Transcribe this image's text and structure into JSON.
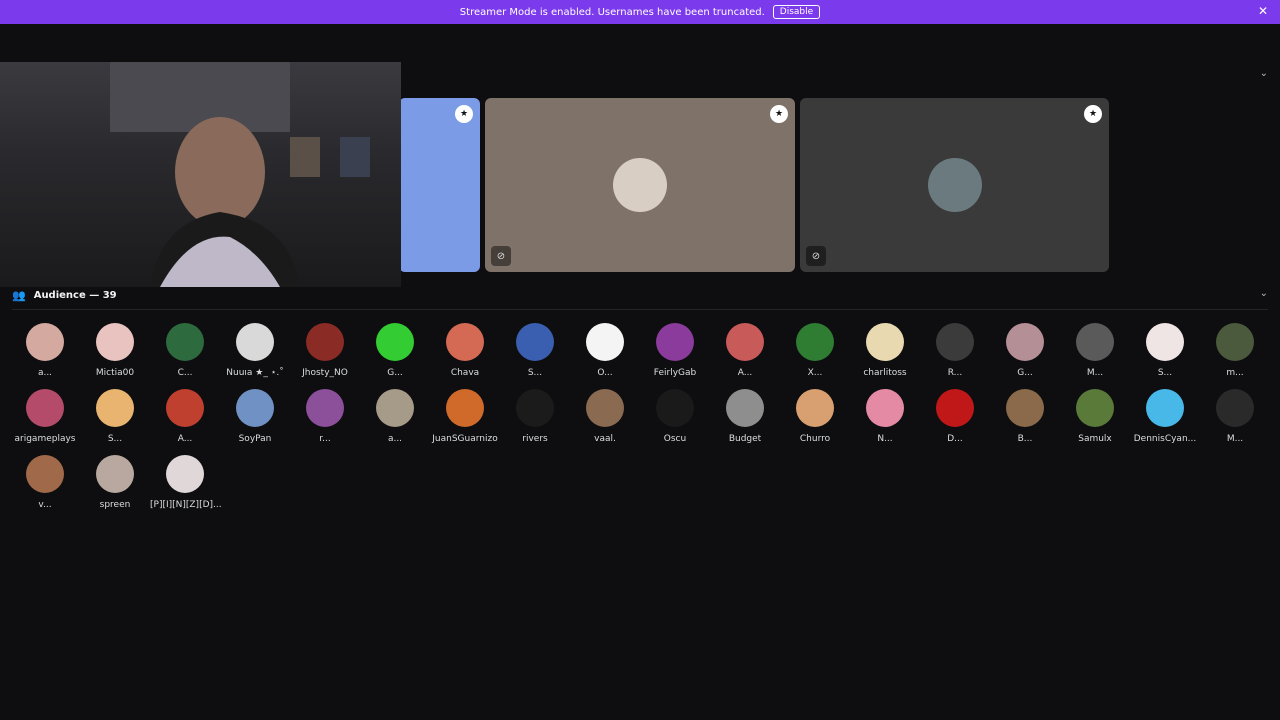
{
  "banner": {
    "text": "Streamer Mode is enabled. Usernames have been truncated.",
    "button": "Disable",
    "close_icon": "close-icon"
  },
  "stage": {
    "chevron_icon": "chevron-down-icon",
    "tiles": [
      {
        "bg": "#7c9be6",
        "badge_icon": "moderator-badge-icon"
      },
      {
        "bg": "#7f7268",
        "badge_icon": "moderator-badge-icon",
        "mute_icon": "muted-mic-icon"
      },
      {
        "bg": "#3a3a3a",
        "badge_icon": "moderator-badge-icon",
        "mute_icon": "muted-mic-icon"
      }
    ]
  },
  "audience": {
    "label": "Audience — 39",
    "icon": "audience-icon",
    "chevron_icon": "chevron-down-icon",
    "members": [
      [
        "a...",
        "#d4a9a0"
      ],
      [
        "Mictia00",
        "#e9c3c0"
      ],
      [
        "C...",
        "#2d6a3e"
      ],
      [
        "Nuuıa ★_ ⋆.˚",
        "#d9d9d9"
      ],
      [
        "Jhosty_NO",
        "#8a2b26"
      ],
      [
        "G...",
        "#33cc33"
      ],
      [
        "Chava",
        "#d46a53"
      ],
      [
        "S...",
        "#3a5fb0"
      ],
      [
        "O...",
        "#f4f4f4"
      ],
      [
        "FeirlyGab",
        "#8a3b9c"
      ],
      [
        "A...",
        "#c95a5a"
      ],
      [
        "X...",
        "#2e7d32"
      ],
      [
        "charlitoss",
        "#e9d9b0"
      ],
      [
        "R...",
        "#3b3b3b"
      ],
      [
        "G...",
        "#b48f95"
      ],
      [
        "M...",
        "#5a5a5a"
      ],
      [
        "S...",
        "#f0e5e5"
      ],
      [
        "m...",
        "#4b5a3c"
      ],
      [
        "arigameplays",
        "#b44b6a"
      ],
      [
        "S...",
        "#e8b470"
      ],
      [
        "A...",
        "#c04030"
      ],
      [
        "SoyPan",
        "#6f91c4"
      ],
      [
        "r...",
        "#8c4f9a"
      ],
      [
        "a...",
        "#a69a88"
      ],
      [
        "JuanSGuarnizo",
        "#d06a2a"
      ],
      [
        "rivers",
        "#1b1b1b"
      ],
      [
        "vaal.",
        "#8a6a50"
      ],
      [
        "Oscu",
        "#1a1a1a"
      ],
      [
        "Budget",
        "#8e8e8e"
      ],
      [
        "Churro",
        "#d8a070"
      ],
      [
        "N...",
        "#e48aa4"
      ],
      [
        "D...",
        "#c01818"
      ],
      [
        "B...",
        "#8a6a4a"
      ],
      [
        "Samulx",
        "#5a7a3a"
      ],
      [
        "DennisCyan...",
        "#48b8e8"
      ],
      [
        "M...",
        "#2a2a2a"
      ],
      [
        "v...",
        "#a06a4a"
      ],
      [
        "spreen",
        "#b8a8a0"
      ],
      [
        "[P][I][N][Z][D]...",
        "#e0d8d8"
      ]
    ]
  }
}
